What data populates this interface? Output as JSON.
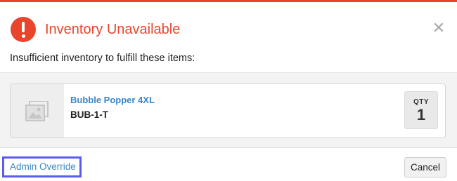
{
  "dialog": {
    "title": "Inventory Unavailable",
    "message": "Insufficient inventory to fulfill these items:",
    "icons": {
      "alert": "alert-circle-icon",
      "close": "close-icon",
      "close_glyph": "✕",
      "placeholder": "image-placeholder-icon"
    },
    "colors": {
      "accent": "#e8452b",
      "link": "#3a86c8",
      "focus_ring": "#5b5bf0"
    }
  },
  "items": [
    {
      "name": "Bubble Popper 4XL",
      "sku": "BUB-1-T",
      "qty_label": "QTY",
      "qty": "1"
    }
  ],
  "footer": {
    "override_label": "Admin Override",
    "cancel_label": "Cancel"
  }
}
